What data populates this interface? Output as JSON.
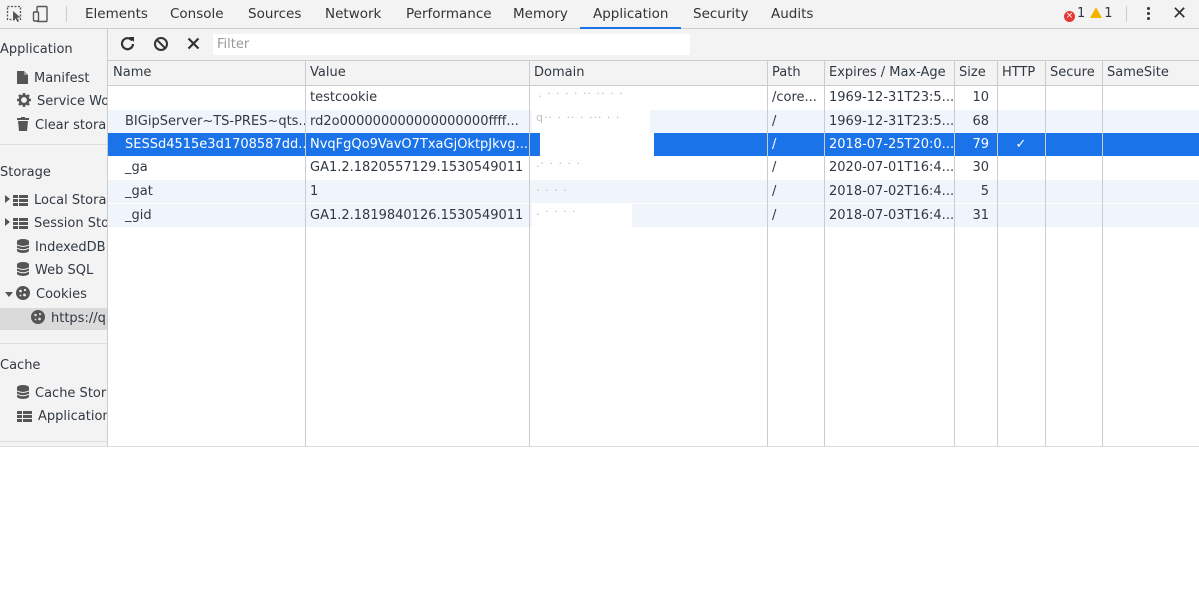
{
  "devtools": {
    "tabs": [
      "Elements",
      "Console",
      "Sources",
      "Network",
      "Performance",
      "Memory",
      "Application",
      "Security",
      "Audits"
    ],
    "active_tab": "Application",
    "error_count": "1",
    "warning_count": "1",
    "accent_color": "#1a73e8"
  },
  "sidebar": {
    "application_heading": "Application",
    "application_items": [
      {
        "label": "Manifest",
        "icon": "document-icon"
      },
      {
        "label": "Service Wo",
        "icon": "gear-icon"
      },
      {
        "label": "Clear stora",
        "icon": "trash-icon"
      }
    ],
    "storage_heading": "Storage",
    "storage_items": [
      {
        "label": "Local Stora",
        "icon": "table-icon"
      },
      {
        "label": "Session Sto",
        "icon": "table-icon"
      },
      {
        "label": "IndexedDB",
        "icon": "database-icon"
      },
      {
        "label": "Web SQL",
        "icon": "database-icon"
      },
      {
        "label": "Cookies",
        "icon": "cookie-icon"
      },
      {
        "label": "https://q",
        "icon": "cookie-icon"
      }
    ],
    "cache_heading": "Cache",
    "cache_items": [
      {
        "label": "Cache Stor",
        "icon": "database-icon"
      },
      {
        "label": "Application",
        "icon": "table-icon"
      }
    ]
  },
  "toolbar": {
    "filter_placeholder": "Filter"
  },
  "cookies_table": {
    "columns": [
      "Name",
      "Value",
      "Domain",
      "Path",
      "Expires / Max-Age",
      "Size",
      "HTTP",
      "Secure",
      "SameSite"
    ],
    "rows": [
      {
        "name": "",
        "value": "testcookie",
        "domain": "",
        "path": "/core...",
        "expires": "1969-12-31T23:5...",
        "size": "10",
        "http": "",
        "secure": "",
        "samesite": ""
      },
      {
        "name": "BIGipServer~TS-PRES~qts...",
        "value": "rd2o000000000000000000ffff...",
        "domain": "",
        "path": "/",
        "expires": "1969-12-31T23:5...",
        "size": "68",
        "http": "",
        "secure": "",
        "samesite": ""
      },
      {
        "name": "SESSd4515e3d1708587dd...",
        "value": "NvqFgQo9VavO7TxaGjOktpJkvg...",
        "domain": "",
        "path": "/",
        "expires": "2018-07-25T20:0...",
        "size": "79",
        "http": "✓",
        "secure": "",
        "samesite": ""
      },
      {
        "name": "_ga",
        "value": "GA1.2.1820557129.1530549011",
        "domain": "",
        "path": "/",
        "expires": "2020-07-01T16:4...",
        "size": "30",
        "http": "",
        "secure": "",
        "samesite": ""
      },
      {
        "name": "_gat",
        "value": "1",
        "domain": "",
        "path": "/",
        "expires": "2018-07-02T16:4...",
        "size": "5",
        "http": "",
        "secure": "",
        "samesite": ""
      },
      {
        "name": "_gid",
        "value": "GA1.2.1819840126.1530549011",
        "domain": "",
        "path": "/",
        "expires": "2018-07-03T16:4...",
        "size": "31",
        "http": "",
        "secure": "",
        "samesite": ""
      }
    ],
    "selected_row": 2
  }
}
